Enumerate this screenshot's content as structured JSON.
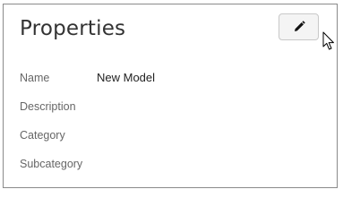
{
  "panel": {
    "title": "Properties",
    "edit_button": {
      "icon": "pencil-icon"
    }
  },
  "properties": [
    {
      "label": "Name",
      "value": "New Model"
    },
    {
      "label": "Description",
      "value": ""
    },
    {
      "label": "Category",
      "value": ""
    },
    {
      "label": "Subcategory",
      "value": ""
    }
  ],
  "colors": {
    "border": "#8a8a8a",
    "title": "#333333",
    "label": "#666666",
    "value": "#222222",
    "button_bg": "#f4f4f4"
  }
}
